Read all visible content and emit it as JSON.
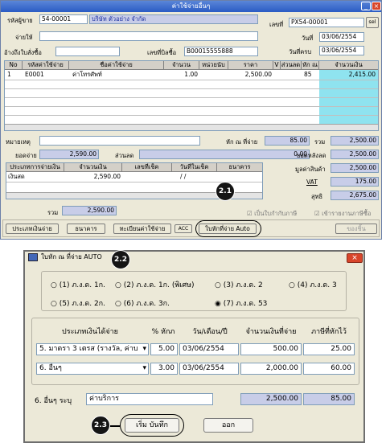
{
  "window1": {
    "title": "ค่าใช้จ่ายอื่นๆ",
    "controls": {
      "minimize": "_",
      "close": "×"
    },
    "vendor_code_label": "รหัสผู้ขาย",
    "vendor_code": "54-00001",
    "vendor_name": "บริษัท ตัวอย่าง จำกัด",
    "pay_to_label": "จ่ายให้",
    "ref_doc_label": "อ้างถึงใบสั่งซื้อ",
    "tax_invoice_label": "เลขที่บิลซื้อ",
    "tax_invoice": "B00015555888",
    "doc_no_label": "เลขที่",
    "doc_no": "PX54-00001",
    "select_label": "sel",
    "date_label": "วันที่",
    "date": "03/06/2554",
    "due_date_label": "วันที่ครบ",
    "due_date": "03/06/2554",
    "grid": {
      "headers": [
        "No",
        "รหัสค่าใช้จ่าย",
        "ชื่อค่าใช้จ่าย",
        "จำนวน",
        "หน่วยนับ",
        "ราคา",
        "V",
        "ส่วนลด",
        "หัก ณ",
        "จำนวนเงิน"
      ],
      "rows": [
        [
          "1",
          "E0001",
          "ค่าโทรศัพท์",
          "1.00",
          "",
          "2,500.00",
          "",
          "",
          "85",
          "2,415.00"
        ]
      ]
    },
    "note_label": "หมายเหตุ",
    "wht_label": "หัก ณ ที่จ่าย",
    "wht": "85.00",
    "total_label": "รวม",
    "total": "2,500.00",
    "paid_label": "ยอดจ่าย",
    "paid": "2,590.00",
    "discount_label": "ส่วนลด",
    "discount": "0.00",
    "after_discount_label": "ยอดหลังลด",
    "after_discount": "2,500.00",
    "goods_value_label": "มูลค่าสินค้า",
    "goods_value": "2,500.00",
    "vat_label": "VAT",
    "vat": "175.00",
    "net_label": "สุทธิ",
    "net": "2,675.00",
    "pay_grid": {
      "headers": [
        "ประเภทการจ่ายเงิน",
        "จำนวนเงิน",
        "เลขที่เช็ค",
        "วันที่ในเช็ค",
        "ธนาคาร"
      ],
      "rows": [
        [
          "เงินสด",
          "2,590.00",
          "",
          "/ /",
          ""
        ]
      ]
    },
    "pay_total_label": "รวม",
    "pay_total": "2,590.00",
    "check_cash": "เป็นใบกำกับภาษี",
    "check_book": "เข้ารายงานภาษีซื้อ",
    "btn_pay_type": "ประเภทเงินจ่าย",
    "btn_bank": "ธนาคาร",
    "btn_register": "ทะเบียนค่าใช้จ่าย",
    "btn_acc": "ACC",
    "btn_wht": "ใบหักที่จ่าย Auto",
    "btn_other": "ของชิ้น",
    "badge": "2.1"
  },
  "window2": {
    "title": "ใบหัก ณ ที่จ่าย AUTO",
    "badge": "2.2",
    "close": "×",
    "radios": [
      "(1) ภ.ง.ด. 1ก.",
      "(2) ภ.ง.ด. 1ก. (พิเศษ)",
      "(3) ภ.ง.ด. 2",
      "(4) ภ.ง.ด. 3",
      "(5) ภ.ง.ด. 2ก.",
      "(6) ภ.ง.ด. 3ก.",
      "(7) ภ.ง.ด. 53"
    ],
    "selected_radio": 6,
    "headers": [
      "ประเภทเงินได้จ่าย",
      "% หักภ",
      "วัน/เดือน/ปี",
      "จำนวนเงินที่จ่าย",
      "ภาษีที่หักไว้"
    ],
    "rows": [
      {
        "type": "5. มาตรา 3 เตรส (รางวัล, ค่าบ",
        "pct": "5.00",
        "date": "03/06/2554",
        "amount": "500.00",
        "tax": "25.00"
      },
      {
        "type": "6. อื่นๆ",
        "pct": "3.00",
        "date": "03/06/2554",
        "amount": "2,000.00",
        "tax": "60.00"
      }
    ],
    "other_label": "6. อื่นๆ ระบุ",
    "other_value": "ค่าบริการ",
    "sum_amount": "2,500.00",
    "sum_tax": "85.00",
    "btn_save": "เริ่ม บันทึก",
    "btn_exit": "ออก",
    "badge_save": "2.3"
  }
}
